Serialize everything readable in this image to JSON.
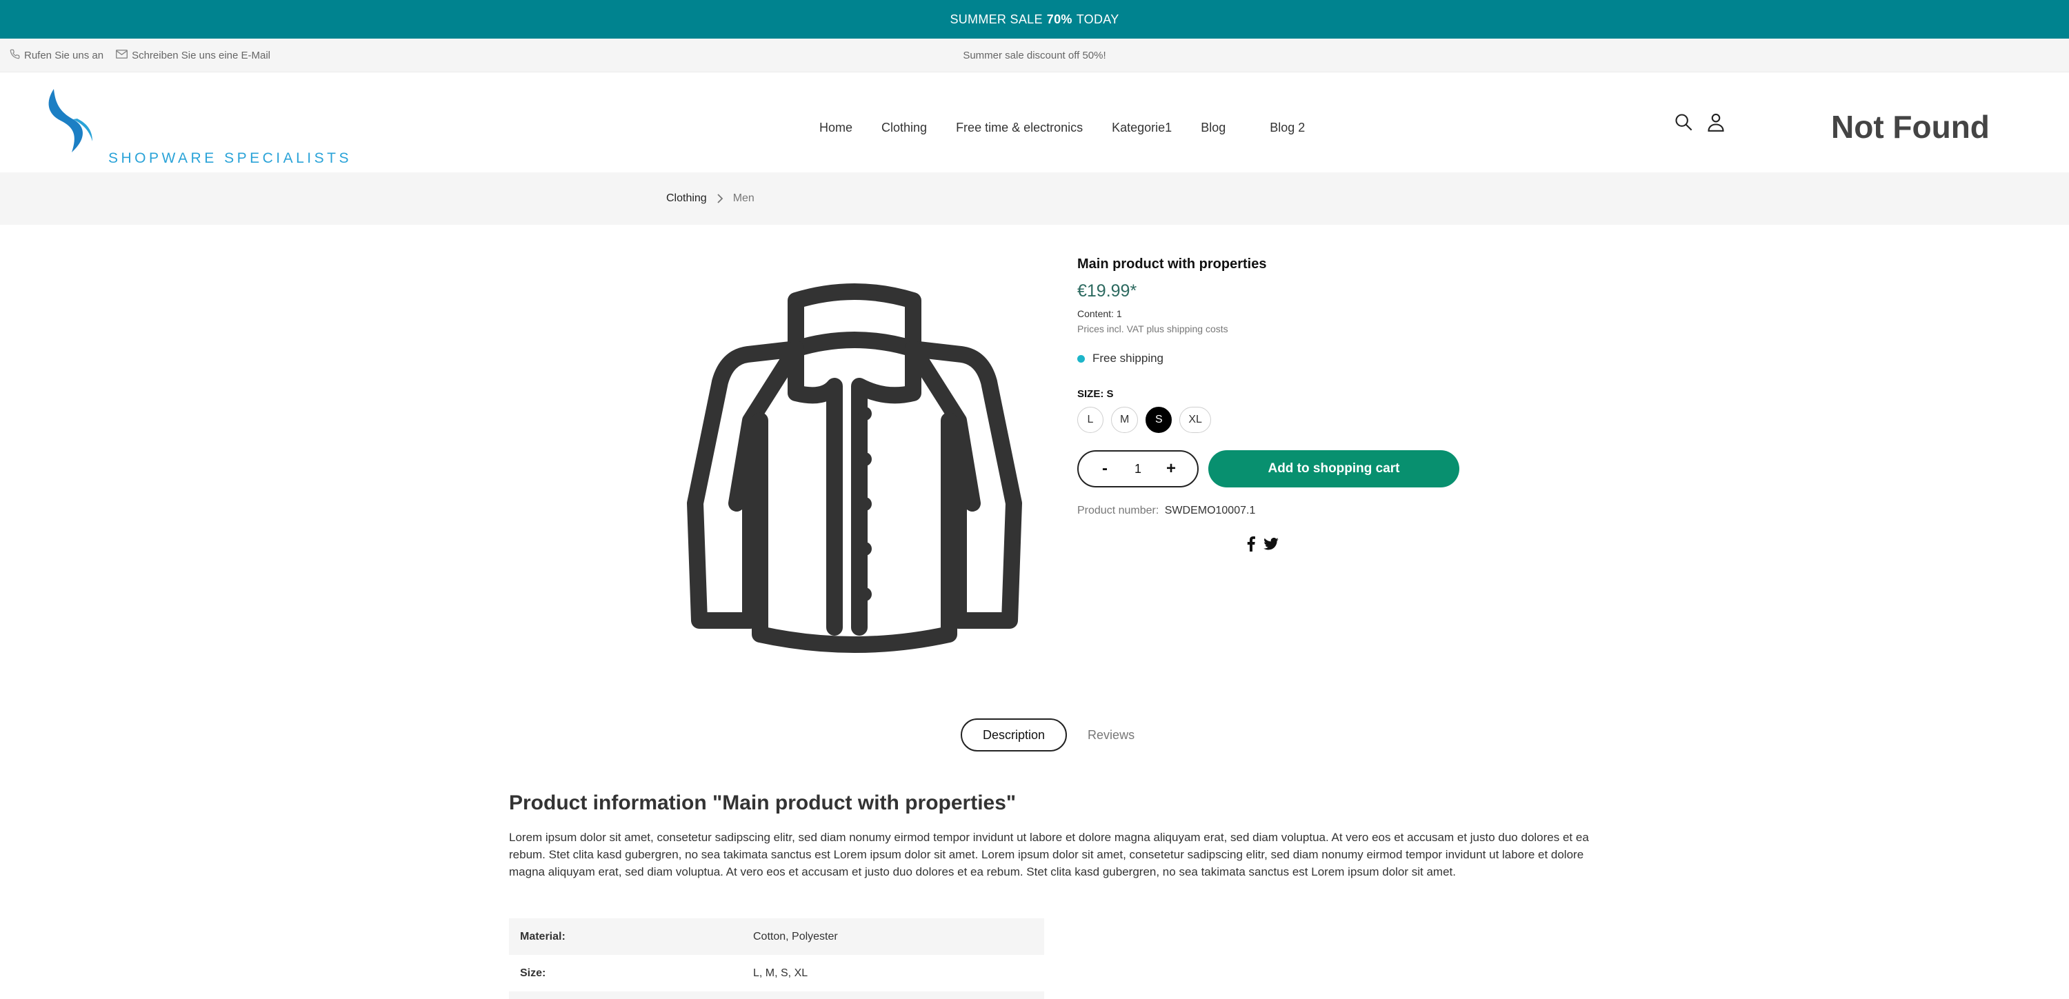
{
  "promo": {
    "prefix": "SUMMER SALE",
    "highlight": "70%",
    "suffix": "TODAY"
  },
  "topbar": {
    "phone_label": "Rufen Sie uns an",
    "email_label": "Schreiben Sie uns eine E-Mail",
    "note": "Summer sale discount off 50%!"
  },
  "header": {
    "logo_text": "SHOPWARE SPECIALISTS",
    "nav": [
      "Home",
      "Clothing",
      "Free time & electronics",
      "Kategorie1",
      "Blog",
      "Blog 2"
    ],
    "not_found": "Not Found"
  },
  "breadcrumb": [
    "Clothing",
    "Men"
  ],
  "product": {
    "title": "Main product with properties",
    "price": "€19.99*",
    "content": "Content: 1",
    "vat_note": "Prices incl. VAT plus shipping costs",
    "shipping": "Free shipping",
    "size_label": "SIZE: S",
    "sizes": [
      "L",
      "M",
      "S",
      "XL"
    ],
    "selected_size": "S",
    "quantity": "1",
    "minus": "-",
    "plus": "+",
    "cart_button": "Add to shopping cart",
    "number_label": "Product number:",
    "number_value": "SWDEMO10007.1"
  },
  "tabs": [
    "Description",
    "Reviews"
  ],
  "description": {
    "heading": "Product information \"Main product with properties\"",
    "text": "Lorem ipsum dolor sit amet, consetetur sadipscing elitr, sed diam nonumy eirmod tempor invidunt ut labore et dolore magna aliquyam erat, sed diam voluptua. At vero eos et accusam et justo duo dolores et ea rebum. Stet clita kasd gubergren, no sea takimata sanctus est Lorem ipsum dolor sit amet. Lorem ipsum dolor sit amet, consetetur sadipscing elitr, sed diam nonumy eirmod tempor invidunt ut labore et dolore magna aliquyam erat, sed diam voluptua. At vero eos et accusam et justo duo dolores et ea rebum. Stet clita kasd gubergren, no sea takimata sanctus est Lorem ipsum dolor sit amet.",
    "properties": [
      {
        "key": "Material:",
        "value": "Cotton, Polyester"
      },
      {
        "key": "Size:",
        "value": "L, M, S, XL"
      }
    ]
  },
  "colors": {
    "promo": "#00838f",
    "cart_button": "#08906f",
    "price": "#2d6a60",
    "shipping_dot": "#1db5c9",
    "logo": "#2aa3d8"
  },
  "icons": [
    "phone-icon",
    "mail-icon",
    "search-icon",
    "user-icon",
    "chevron-right-icon",
    "facebook-icon",
    "twitter-icon",
    "jacket-image"
  ]
}
